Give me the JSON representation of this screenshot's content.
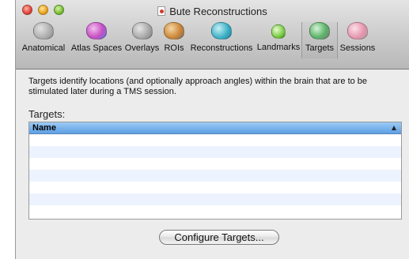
{
  "window": {
    "title": "Bute Reconstructions"
  },
  "toolbar": {
    "items": [
      {
        "label": "Anatomical",
        "icon": "brain-gray-icon",
        "color": "#9a9a9a"
      },
      {
        "label": "Atlas Spaces",
        "icon": "brain-atlas-icon",
        "color": "#d05cc8"
      },
      {
        "label": "Overlays",
        "icon": "brain-overlay-icon",
        "color": "#8f8f8f"
      },
      {
        "label": "ROIs",
        "icon": "brain-roi-icon",
        "color": "#d69a4a"
      },
      {
        "label": "Reconstructions",
        "icon": "brain-reconstruction-icon",
        "color": "#4ab6c9"
      },
      {
        "label": "Landmarks",
        "icon": "landmark-leaf-icon",
        "color": "#7ed04a"
      },
      {
        "label": "Targets",
        "icon": "brain-targets-icon",
        "color": "#5fb56a"
      },
      {
        "label": "Sessions",
        "icon": "brain-sessions-icon",
        "color": "#e59ab0"
      }
    ],
    "selected": "Targets"
  },
  "content": {
    "description": "Targets identify locations (and optionally approach angles) within the brain that are to be stimulated later during a TMS session.",
    "targets_label": "Targets:",
    "table": {
      "columns": [
        "Name"
      ],
      "rows": []
    },
    "configure_button": "Configure Targets..."
  }
}
